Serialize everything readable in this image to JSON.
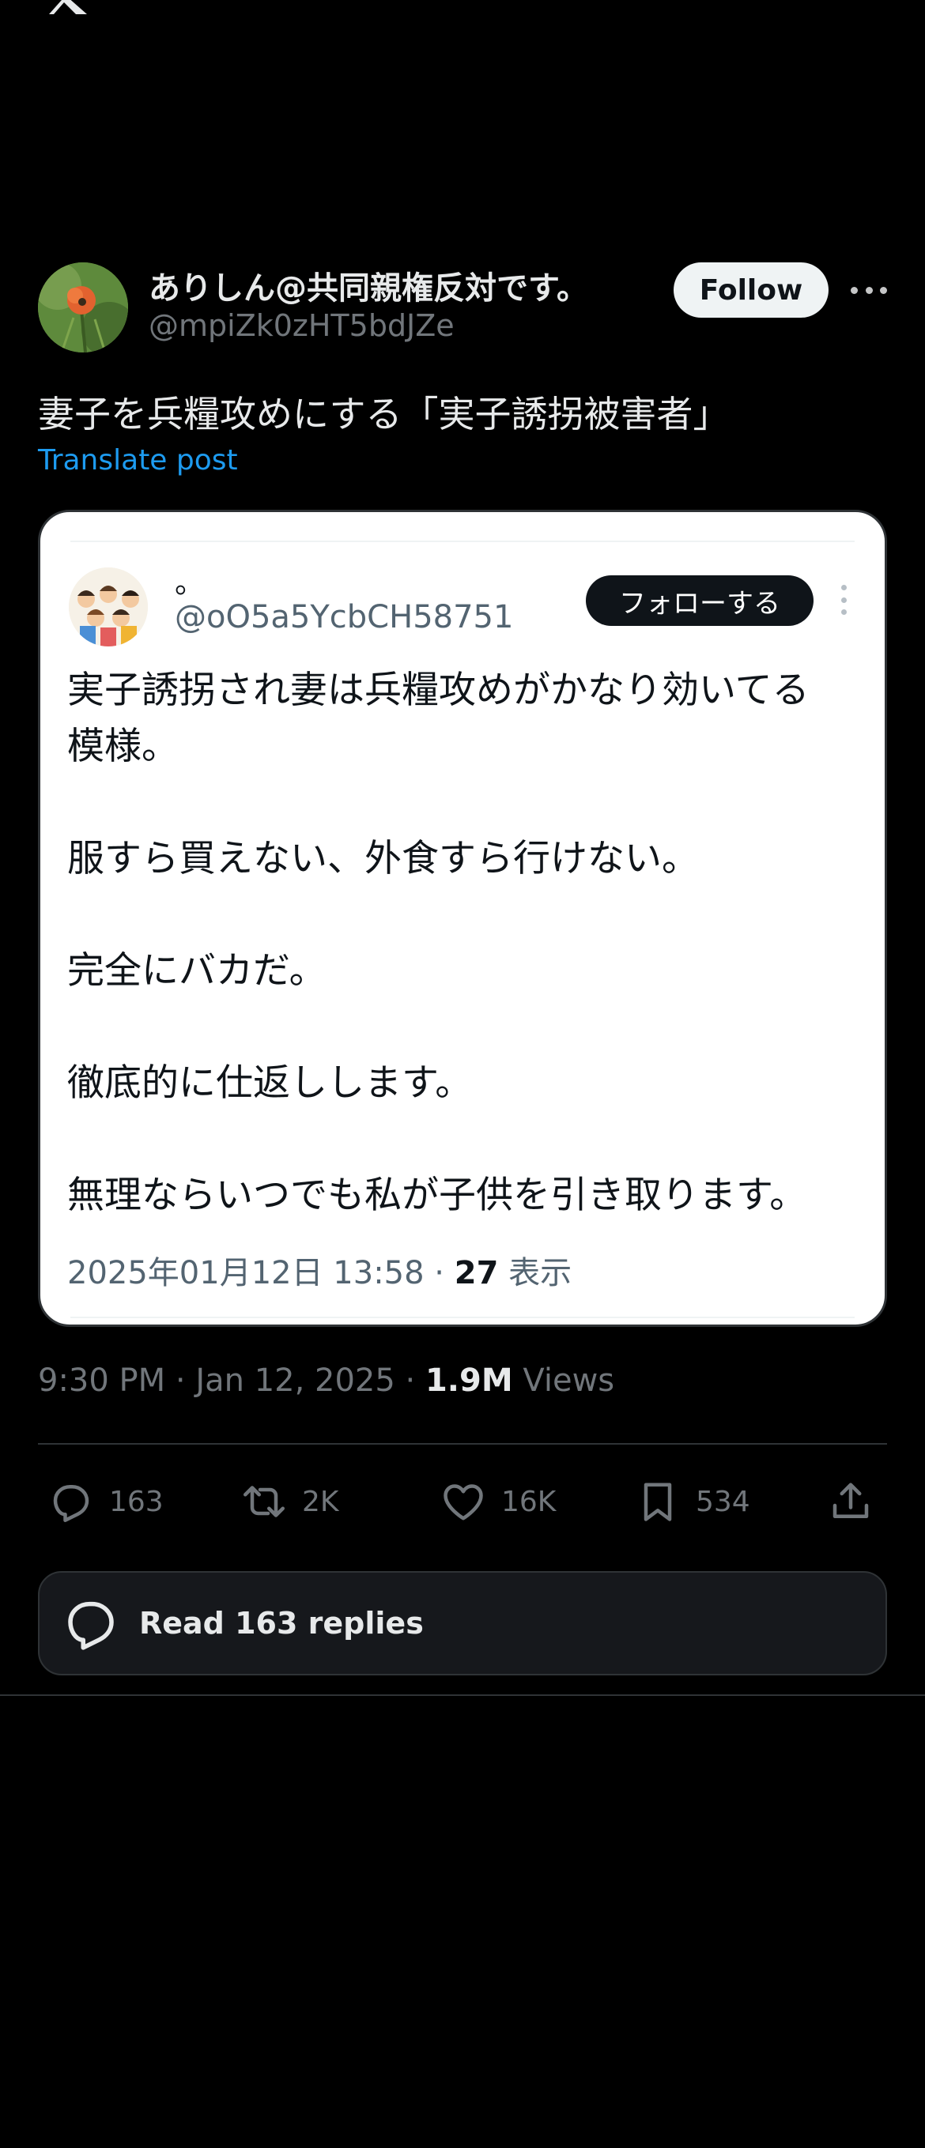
{
  "author": {
    "display_name": "ありしん@共同親権反対です。",
    "handle": "@mpiZk0zHT5bdJZe",
    "follow_label": "Follow"
  },
  "post": {
    "text": "妻子を兵糧攻めにする「実子誘拐被害者」",
    "translate_label": "Translate post"
  },
  "quoted_card": {
    "name": "。",
    "handle": "@oO5a5YcbCH58751",
    "follow_label": "フォローする",
    "body_lines": [
      "実子誘拐され妻は兵糧攻めがかなり効いてる",
      "模様。",
      "",
      "服すら買えない、外食すら行けない。",
      "",
      "完全にバカだ。",
      "",
      "徹底的に仕返しします。",
      "",
      "無理ならいつでも私が子供を引き取ります。"
    ],
    "timestamp": "2025年01月12日 13:58 · ",
    "views_count": "27",
    "views_label": " 表示"
  },
  "meta": {
    "time": "9:30 PM · Jan 12, 2025 · ",
    "views_count": "1.9M",
    "views_label": " Views"
  },
  "actions": {
    "replies": "163",
    "reposts": "2K",
    "likes": "16K",
    "bookmarks": "534"
  },
  "read_replies_label": "Read 163 replies",
  "colors": {
    "background": "#000000",
    "link_blue": "#1d9bf0",
    "secondary_text": "#71767b",
    "border": "#2f3336"
  }
}
